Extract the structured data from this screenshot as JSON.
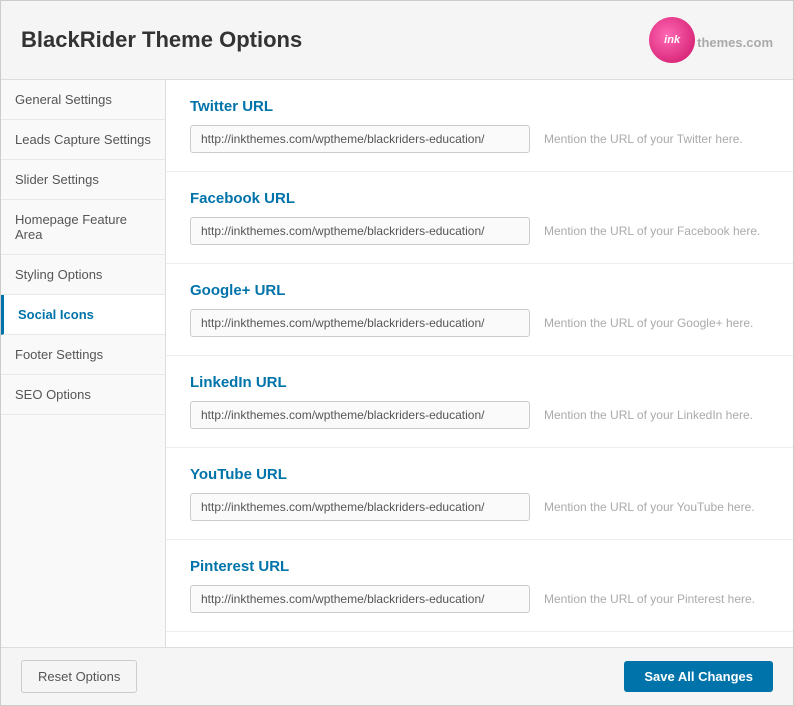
{
  "header": {
    "title": "BlackRider Theme Options",
    "logo_text": "ink",
    "logo_brand": "themes",
    "logo_tld": ".com"
  },
  "sidebar": {
    "items": [
      {
        "id": "general-settings",
        "label": "General Settings",
        "active": false
      },
      {
        "id": "leads-capture-settings",
        "label": "Leads Capture Settings",
        "active": false
      },
      {
        "id": "slider-settings",
        "label": "Slider Settings",
        "active": false
      },
      {
        "id": "homepage-feature-area",
        "label": "Homepage Feature Area",
        "active": false
      },
      {
        "id": "styling-options",
        "label": "Styling Options",
        "active": false
      },
      {
        "id": "social-icons",
        "label": "Social Icons",
        "active": true
      },
      {
        "id": "footer-settings",
        "label": "Footer Settings",
        "active": false
      },
      {
        "id": "seo-options",
        "label": "SEO Options",
        "active": false
      }
    ]
  },
  "main": {
    "fields": [
      {
        "id": "twitter-url",
        "title": "Twitter URL",
        "value": "http://inkthemes.com/wptheme/blackriders-education/",
        "hint": "Mention the URL of your Twitter here."
      },
      {
        "id": "facebook-url",
        "title": "Facebook URL",
        "value": "http://inkthemes.com/wptheme/blackriders-education/",
        "hint": "Mention the URL of your Facebook here."
      },
      {
        "id": "googleplus-url",
        "title": "Google+ URL",
        "value": "http://inkthemes.com/wptheme/blackriders-education/",
        "hint": "Mention the URL of your Google+ here."
      },
      {
        "id": "linkedin-url",
        "title": "LinkedIn URL",
        "value": "http://inkthemes.com/wptheme/blackriders-education/",
        "hint": "Mention the URL of your LinkedIn here."
      },
      {
        "id": "youtube-url",
        "title": "YouTube URL",
        "value": "http://inkthemes.com/wptheme/blackriders-education/",
        "hint": "Mention the URL of your YouTube here."
      },
      {
        "id": "pinterest-url",
        "title": "Pinterest URL",
        "value": "http://inkthemes.com/wptheme/blackriders-education/",
        "hint": "Mention the URL of your Pinterest here."
      }
    ]
  },
  "footer": {
    "reset_label": "Reset Options",
    "save_label": "Save All Changes"
  }
}
